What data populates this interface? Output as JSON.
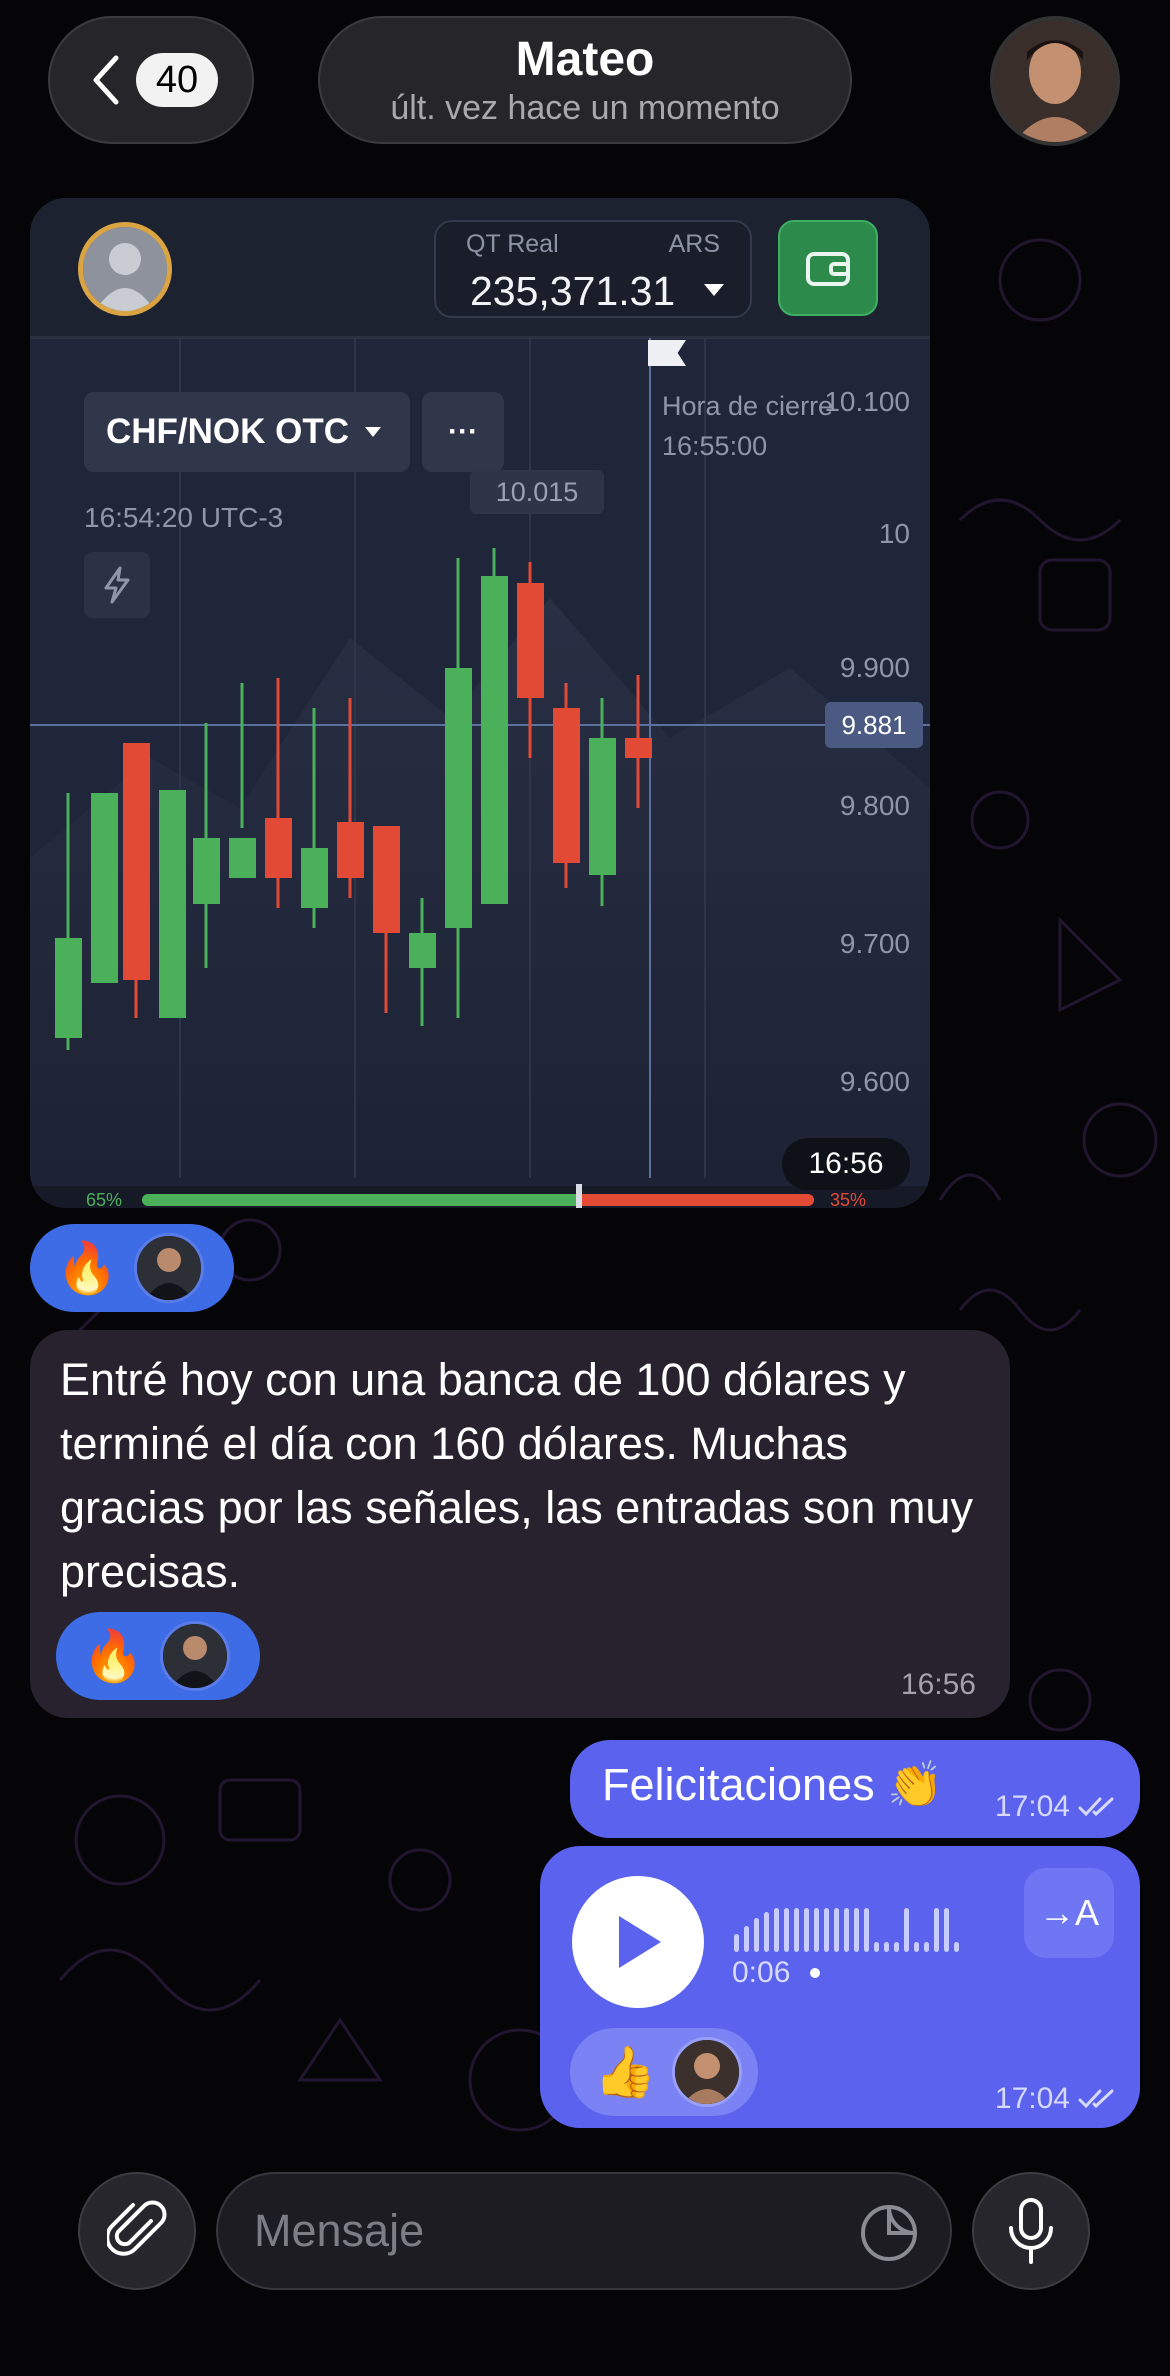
{
  "header": {
    "back_count": "40",
    "contact_name": "Mateo",
    "contact_status": "últ. vez hace un momento"
  },
  "screenshot": {
    "balance_label": "QT Real",
    "balance_currency": "ARS",
    "balance_value": "235,371.31",
    "pair": "CHF/NOK OTC",
    "more": "···",
    "server_time": "16:54:20 UTC-3",
    "high_tag": "10.015",
    "close_label": "Hora de cierre",
    "close_time": "16:55:00",
    "axis": [
      "10.100",
      "10",
      "9.900",
      "9.800",
      "9.700",
      "9.600"
    ],
    "current_price": "9.881",
    "sentiment_up": "65%",
    "sentiment_down": "35%",
    "sentiment_up_fraction": 0.65,
    "timestamp": "16:56",
    "up_color": "#4ab05a",
    "down_color": "#e24a36"
  },
  "reactions_1": {
    "emoji": "🔥"
  },
  "incoming": {
    "text": "Entré hoy con una banca de 100 dólares y terminé el día con 160 dólares. Muchas gracias por las señales, las entradas son muy precisas.",
    "reaction_emoji": "🔥",
    "time": "16:56"
  },
  "outgoing": {
    "text": "Felicitaciones 👏",
    "time": "17:04",
    "voice_duration": "0:06",
    "voice_transcribe": "→A",
    "voice_reaction": "👍",
    "voice_time": "17:04",
    "bubble_color": "#5a62ee"
  },
  "input": {
    "placeholder": "Mensaje"
  }
}
